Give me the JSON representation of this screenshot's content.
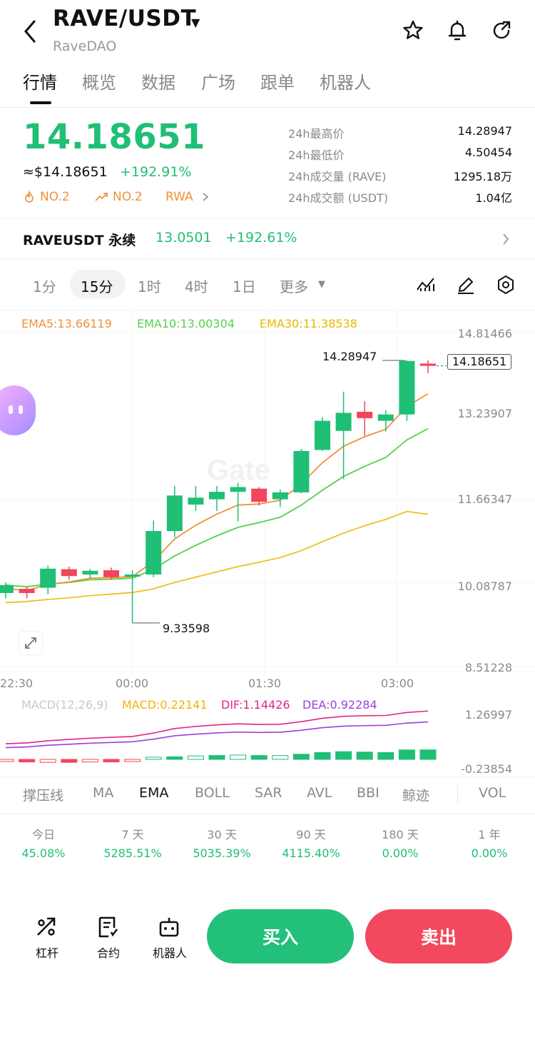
{
  "header": {
    "title": "RAVE/USDT",
    "subtitle": "RaveDAO"
  },
  "tabs": [
    "行情",
    "概览",
    "数据",
    "广场",
    "跟单",
    "机器人"
  ],
  "price": {
    "last": "14.18651",
    "usd": "≈$14.18651",
    "change": "+192.91%"
  },
  "tags": {
    "hot": "NO.2",
    "gainers": "NO.2",
    "sector": "RWA"
  },
  "stats": [
    {
      "label": "24h最高价",
      "value": "14.28947"
    },
    {
      "label": "24h最低价",
      "value": "4.50454"
    },
    {
      "label": "24h成交量 (RAVE)",
      "value": "1295.18万"
    },
    {
      "label": "24h成交额 (USDT)",
      "value": "1.04亿"
    }
  ],
  "perp": {
    "name": "RAVEUSDT 永续",
    "price": "13.0501",
    "change": "+192.61%"
  },
  "intervals": [
    "1分",
    "15分",
    "1时",
    "4时",
    "1日",
    "更多"
  ],
  "chart": {
    "ema5": "EMA5:13.66119",
    "ema10": "EMA10:13.00304",
    "ema30": "EMA30:11.38538",
    "y_labels": [
      "14.81466",
      "13.23907",
      "11.66347",
      "10.08787",
      "8.51228"
    ],
    "high_label": "14.28947",
    "low_label": "9.33598",
    "last_label": "14.18651",
    "time_labels": [
      "22:30",
      "00:00",
      "01:30",
      "03:00"
    ],
    "watermark": "Gate",
    "colors": {
      "up": "#1fbf75",
      "down": "#f2455d",
      "ema5": "#f0913a",
      "ema10": "#52d34a",
      "ema30": "#f0c020"
    }
  },
  "macd": {
    "title": "MACD(12,26,9)",
    "macd": "MACD:0.22141",
    "dif": "DIF:1.14426",
    "dea": "DEA:0.92284",
    "y_labels": [
      "1.26997",
      "-0.23854"
    ]
  },
  "indicators": [
    "撑压线",
    "MA",
    "EMA",
    "BOLL",
    "SAR",
    "AVL",
    "BBI",
    "鲸迹",
    "VOL"
  ],
  "performance": [
    {
      "label": "今日",
      "value": "45.08%"
    },
    {
      "label": "7 天",
      "value": "5285.51%"
    },
    {
      "label": "30 天",
      "value": "5035.39%"
    },
    {
      "label": "90 天",
      "value": "4115.40%"
    },
    {
      "label": "180 天",
      "value": "0.00%"
    },
    {
      "label": "1 年",
      "value": "0.00%"
    }
  ],
  "bottom": {
    "leverage": "杠杆",
    "contract": "合约",
    "bot": "机器人",
    "buy": "买入",
    "sell": "卖出"
  },
  "chart_data": {
    "type": "candlestick",
    "interval": "15m",
    "ylim": [
      8.51228,
      14.81466
    ],
    "candles": [
      {
        "o": 9.9,
        "c": 10.05,
        "h": 10.1,
        "l": 9.8
      },
      {
        "o": 9.98,
        "c": 9.9,
        "h": 10.02,
        "l": 9.8
      },
      {
        "o": 10.0,
        "c": 10.36,
        "h": 10.42,
        "l": 9.88
      },
      {
        "o": 10.35,
        "c": 10.22,
        "h": 10.4,
        "l": 10.15
      },
      {
        "o": 10.25,
        "c": 10.32,
        "h": 10.36,
        "l": 10.18
      },
      {
        "o": 10.33,
        "c": 10.2,
        "h": 10.38,
        "l": 10.15
      },
      {
        "o": 10.22,
        "c": 10.25,
        "h": 10.33,
        "l": 9.33598
      },
      {
        "o": 10.25,
        "c": 11.07,
        "h": 11.27,
        "l": 10.2
      },
      {
        "o": 11.07,
        "c": 11.74,
        "h": 11.92,
        "l": 10.95
      },
      {
        "o": 11.57,
        "c": 11.7,
        "h": 11.92,
        "l": 11.45
      },
      {
        "o": 11.67,
        "c": 11.81,
        "h": 11.92,
        "l": 11.45
      },
      {
        "o": 11.81,
        "c": 11.9,
        "h": 11.98,
        "l": 11.25
      },
      {
        "o": 11.87,
        "c": 11.62,
        "h": 11.9,
        "l": 11.55
      },
      {
        "o": 11.67,
        "c": 11.8,
        "h": 11.85,
        "l": 11.52
      },
      {
        "o": 11.8,
        "c": 12.58,
        "h": 12.62,
        "l": 11.78
      },
      {
        "o": 12.6,
        "c": 13.15,
        "h": 13.22,
        "l": 12.58
      },
      {
        "o": 12.96,
        "c": 13.3,
        "h": 13.7,
        "l": 12.05
      },
      {
        "o": 13.32,
        "c": 13.2,
        "h": 13.52,
        "l": 12.87
      },
      {
        "o": 13.15,
        "c": 13.27,
        "h": 13.35,
        "l": 12.95
      },
      {
        "o": 13.27,
        "c": 14.28,
        "h": 14.28947,
        "l": 13.15
      },
      {
        "o": 14.23,
        "c": 14.18651,
        "h": 14.28947,
        "l": 14.05
      }
    ],
    "ema5": [
      9.98,
      9.95,
      10.06,
      10.11,
      10.18,
      10.19,
      10.21,
      10.5,
      10.92,
      11.18,
      11.39,
      11.56,
      11.58,
      11.65,
      11.96,
      12.36,
      12.67,
      12.85,
      12.99,
      13.42,
      13.66119
    ],
    "ema10": [
      10.05,
      10.02,
      10.07,
      10.1,
      10.15,
      10.16,
      10.18,
      10.35,
      10.6,
      10.8,
      10.98,
      11.14,
      11.23,
      11.33,
      11.56,
      11.84,
      12.1,
      12.29,
      12.46,
      12.79,
      13.00304
    ],
    "ema30": [
      9.72,
      9.74,
      9.78,
      9.81,
      9.85,
      9.88,
      9.91,
      9.98,
      10.1,
      10.2,
      10.3,
      10.4,
      10.48,
      10.57,
      10.7,
      10.87,
      11.03,
      11.17,
      11.29,
      11.44,
      11.38538
    ],
    "macd_hist": [
      -0.05,
      -0.06,
      -0.07,
      -0.07,
      -0.06,
      -0.06,
      -0.05,
      0.02,
      0.06,
      0.08,
      0.09,
      0.1,
      0.09,
      0.09,
      0.12,
      0.16,
      0.18,
      0.17,
      0.16,
      0.22,
      0.22141
    ],
    "x_tick_labels": [
      "22:30",
      "00:00",
      "01:30",
      "03:00"
    ]
  }
}
